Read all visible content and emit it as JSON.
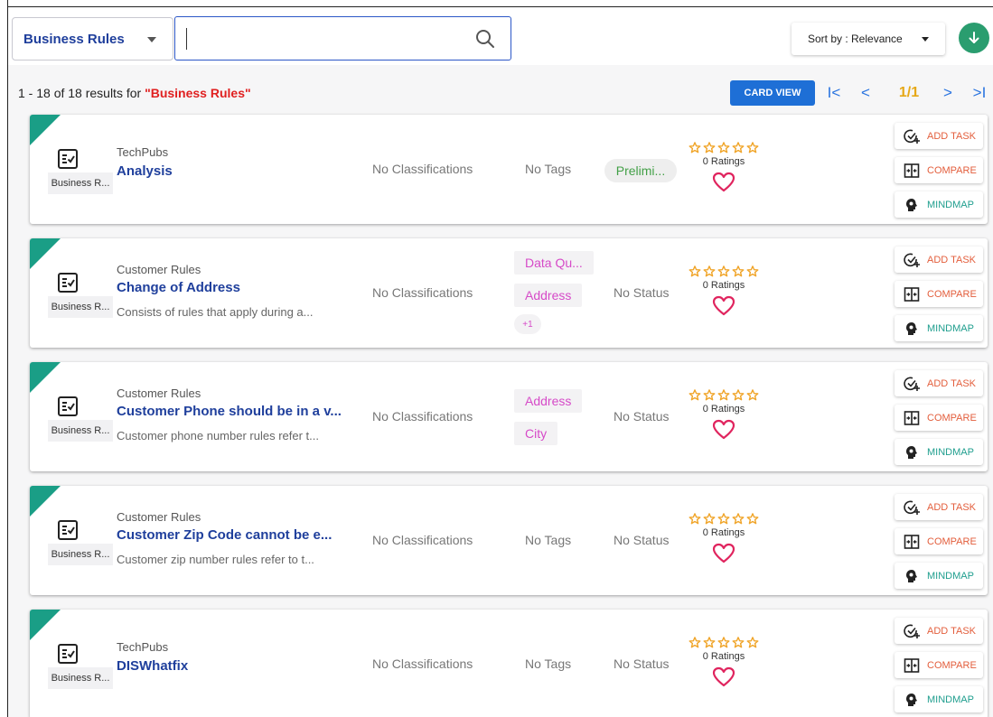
{
  "filter": {
    "label": "Business Rules"
  },
  "search": {
    "value": ""
  },
  "sort": {
    "label": "Sort by : Relevance"
  },
  "results": {
    "count_text": "1 - 18 of 18 results for ",
    "query": "\"Business Rules\""
  },
  "view_button": {
    "label": "CARD VIEW"
  },
  "pagination": {
    "first": "I<",
    "prev": "<",
    "page": "1/1",
    "next": ">",
    "last": ">I"
  },
  "colors": {
    "accent": "#1e6fd6",
    "brand_blue": "#1f3f9c",
    "corner_green": "#1a9e86",
    "query_red": "#e02020",
    "star": "#f0a52a",
    "heart": "#e0245e",
    "tag_pink": "#d64ac8",
    "status_green": "#43a047",
    "download_green": "#2a9d6f"
  },
  "icons": {
    "search": "search-icon",
    "download": "arrow-down-icon",
    "type": "checklist-document-icon",
    "add_task": "check-circle-plus-icon",
    "compare": "compare-icon",
    "mindmap": "brain-head-icon",
    "like": "heart-icon",
    "star": "star-icon"
  },
  "actions": {
    "add_task": "ADD TASK",
    "compare": "COMPARE",
    "mindmap": "MINDMAP"
  },
  "cards": [
    {
      "type_label": "Business R...",
      "owner": "TechPubs",
      "title": "Analysis",
      "description": "",
      "classification": "No Classifications",
      "tags_text": "No Tags",
      "tags": [],
      "tags_more": "",
      "status": "Prelimi...",
      "status_is_pill": true,
      "ratings_text": "0 Ratings",
      "rating": 0
    },
    {
      "type_label": "Business R...",
      "owner": "Customer Rules",
      "title": "Change of Address",
      "description": "Consists of rules that apply during a...",
      "classification": "No Classifications",
      "tags_text": "",
      "tags": [
        "Data Qu...",
        "Address"
      ],
      "tags_more": "+1",
      "status": "No Status",
      "status_is_pill": false,
      "ratings_text": "0 Ratings",
      "rating": 0
    },
    {
      "type_label": "Business R...",
      "owner": "Customer Rules",
      "title": "Customer Phone should be in a v...",
      "description": "Customer phone number rules refer t...",
      "classification": "No Classifications",
      "tags_text": "",
      "tags": [
        "Address",
        "City"
      ],
      "tags_more": "",
      "status": "No Status",
      "status_is_pill": false,
      "ratings_text": "0 Ratings",
      "rating": 0
    },
    {
      "type_label": "Business R...",
      "owner": "Customer Rules",
      "title": "Customer Zip Code cannot be e...",
      "description": "Customer zip number rules refer to t...",
      "classification": "No Classifications",
      "tags_text": "No Tags",
      "tags": [],
      "tags_more": "",
      "status": "No Status",
      "status_is_pill": false,
      "ratings_text": "0 Ratings",
      "rating": 0
    },
    {
      "type_label": "Business R...",
      "owner": "TechPubs",
      "title": "DISWhatfix",
      "description": "",
      "classification": "No Classifications",
      "tags_text": "No Tags",
      "tags": [],
      "tags_more": "",
      "status": "No Status",
      "status_is_pill": false,
      "ratings_text": "0 Ratings",
      "rating": 0
    }
  ]
}
